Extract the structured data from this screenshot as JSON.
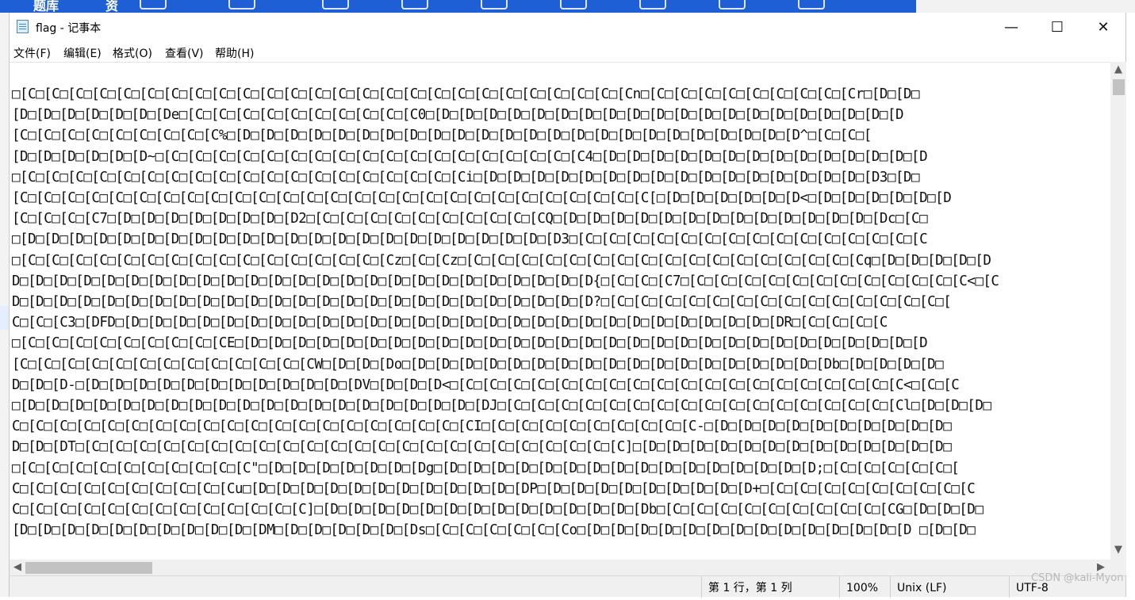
{
  "background_app": {
    "tab_label": "题库",
    "tab_label_2": "资"
  },
  "window": {
    "title": "flag - 记事本",
    "minimize_glyph": "—",
    "maximize_glyph": "☐",
    "close_glyph": "✕"
  },
  "menu": {
    "file": "文件(F)",
    "edit": "编辑(E)",
    "format": "格式(O)",
    "view": "查看(V)",
    "help": "帮助(H)"
  },
  "editor": {
    "lines": [
      "□[C□[C□[C□[C□[C□[C□[C□[C□[C□[C□[C□[C□[C□[C□[C□[C□[C□[C□[C□[C□[C□[C□[C□[C□[C□[Cn□[C□[C□[C□[C□[C□[C□[C□[C□[Cr□[D□[D□",
      "[D□[D□[D□[D□[D□[D□[De□[C□[C□[C□[C□[C□[C□[C□[C□[C□[C0□[D□[D□[D□[D□[D□[D□[D□[D□[D□[D□[D□[D□[D□[D□[D□[D□[D□[D□[D□[D",
      "[C□[C□[C□[C□[C□[C□[C□[C□[C%□[D□[D□[D□[D□[D□[D□[D□[D□[D□[D□[D□[D□[D□[D□[D□[D□[D□[D□[D□[D□[D□[D□[D□[D^□[C□[C□[",
      "[D□[D□[D□[D□[D□[D~□[C□[C□[C□[C□[C□[C□[C□[C□[C□[C□[C□[C□[C□[C□[C□[C□[C□[C4□[D□[D□[D□[D□[D□[D□[D□[D□[D□[D□[D□[D□[D□[D",
      "□[C□[C□[C□[C□[C□[C□[C□[C□[C□[C□[C□[C□[C□[C□[C□[C□[C□[C□[Ci□[D□[D□[D□[D□[D□[D□[D□[D□[D□[D□[D□[D□[D□[D□[D□[D□[D3□[D□",
      "[C□[C□[C□[C□[C□[C□[C□[C□[C□[C□[C□[C□[C□[C□[C□[C□[C□[C□[C□[C□[C□[C□[C□[C□[C□[C□[C[□[D□[D□[D□[D□[D□[D<□[D□[D□[D□[D□[D□[D",
      "[C□[C□[C□[C7□[D□[D□[D□[D□[D□[D□[D□[D2□[C□[C□[C□[C□[C□[C□[C□[C□[C□[CQ□[D□[D□[D□[D□[D□[D□[D□[D□[D□[D□[D□[D□[D□[Dc□[C□",
      "□[D□[D□[D□[D□[D□[D□[D□[D□[D□[D□[D□[D□[D□[D□[D□[D□[D□[D□[D□[D□[D□[D□[D3□[C□[C□[C□[C□[C□[C□[C□[C□[C□[C□[C□[C□[C□[C□[C",
      "□[C□[C□[C□[C□[C□[C□[C□[C□[C□[C□[C□[C□[C□[C□[C□[Cz□[C□[Cz□[C□[C□[C□[C□[C□[C□[C□[C□[C□[C□[C□[C□[C□[C□[C□[C□[Cq□[D□[D□[D□[D□[D",
      "D□[D□[D□[D□[D□[D□[D□[D□[D□[D□[D□[D□[D□[D□[D□[D□[D□[D□[D□[D□[D□[D□[D□[D□[D{□[C□[C□[C7□[C□[C□[C□[C□[C□[C□[C□[C□[C□[C□[C□[C<□[C",
      "D□[D□[D□[D□[D□[D□[D□[D□[D□[D□[D□[D□[D□[D□[D□[D□[D□[D□[D□[D□[D□[D□[D□[D□[D?□[C□[C□[C□[C□[C□[C□[C□[C□[C□[C□[C□[C□[C□[C□[",
      "C□[C□[C3□[DFD□[D□[D□[D□[D□[D□[D□[D□[D□[D□[D□[D□[D□[D□[D□[D□[D□[D□[D□[D□[D□[D□[D□[D□[D□[D□[D□[D□[DR□[C□[C□[C□[C",
      "□[C□[C□[C□[C□[C□[C□[C□[C□[CE□[D□[D□[D□[D□[D□[D□[D□[D□[D□[D□[D□[D□[D□[D□[D□[D□[D□[D□[D□[D□[D□[D□[D□[D□[D□[D□[D□[D□[D",
      "[C□[C□[C□[C□[C□[C□[C□[C□[C□[C□[C□[C□[CW□[D□[D□[Do□[D□[D□[D□[D□[D□[D□[D□[D□[D□[D□[D□[D□[D□[D□[D□[D□[D□[Db□[D□[D□[D□[D□",
      "D□[D□[D-□[D□[D□[D□[D□[D□[D□[D□[D□[D□[D□[D□[DV□[D□[D□[D<□[C□[C□[C□[C□[C□[C□[C□[C□[C□[C□[C□[C□[C□[C□[C□[C□[C□[C□[C<□[C□[C",
      "□[D□[D□[D□[D□[D□[D□[D□[D□[D□[D□[D□[D□[D□[D□[D□[D□[D□[D□[D□[DJ□[C□[C□[C□[C□[C□[C□[C□[C□[C□[C□[C□[C□[C□[C□[C□[C□[Cl□[D□[D□[D□",
      "C□[C□[C□[C□[C□[C□[C□[C□[C□[C□[C□[C□[C□[C□[C□[C□[C□[C□[C□[CI□[C□[C□[C□[C□[C□[C□[C□[C□[C-□[D□[D□[D□[D□[D□[D□[D□[D□[D□[D□",
      "D□[D□[DT□[C□[C□[C□[C□[C□[C□[C□[C□[C□[C□[C□[C□[C□[C□[C□[C□[C□[C□[C□[C□[C□[C□[C]□[D□[D□[D□[D□[D□[D□[D□[D□[D□[D□[D□[D□[D□",
      "□[C□[C□[C□[C□[C□[C□[C□[C□[C□[C\"□[D□[D□[D□[D□[D□[D□[Dg□[D□[D□[D□[D□[D□[D□[D□[D□[D□[D□[D□[D□[D□[D□[D□[D;□[C□[C□[C□[C□[C□[",
      "C□[C□[C□[C□[C□[C□[C□[C□[C□[Cu□[D□[D□[D□[D□[D□[D□[D□[D□[D□[D□[D□[DP□[D□[D□[D□[D□[D□[D□[D□[D□[D+□[C□[C□[C□[C□[C□[C□[C□[C□[C",
      "C□[C□[C□[C□[C□[C□[C□[C□[C□[C□[C□[C□[C]□[D□[D□[D□[D□[D□[D□[D□[D□[D□[D□[D□[D□[D□[Db□[C□[C□[C□[C□[C□[C□[C□[C□[C□[CG□[D□[D□[D□",
      "[D□[D□[D□[D□[D□[D□[D□[D□[D□[D□[DM□[D□[D□[D□[D□[D□[Ds□[C□[C□[C□[C□[C□[Co□[D□[D□[D□[D□[D□[D□[D□[D□[D□[D□[D□[D□[D□[D □[D□[D□"
    ]
  },
  "statusbar": {
    "position": "第 1 行，第 1 列",
    "zoom": "100%",
    "line_ending": "Unix (LF)",
    "encoding": "UTF-8"
  },
  "watermark": "CSDN @kali-Myon",
  "icons": {
    "app": "notepad-icon",
    "scroll_up": "chevron-up-icon",
    "scroll_down": "chevron-down-icon",
    "scroll_left": "chevron-left-icon",
    "scroll_right": "chevron-right-icon"
  }
}
